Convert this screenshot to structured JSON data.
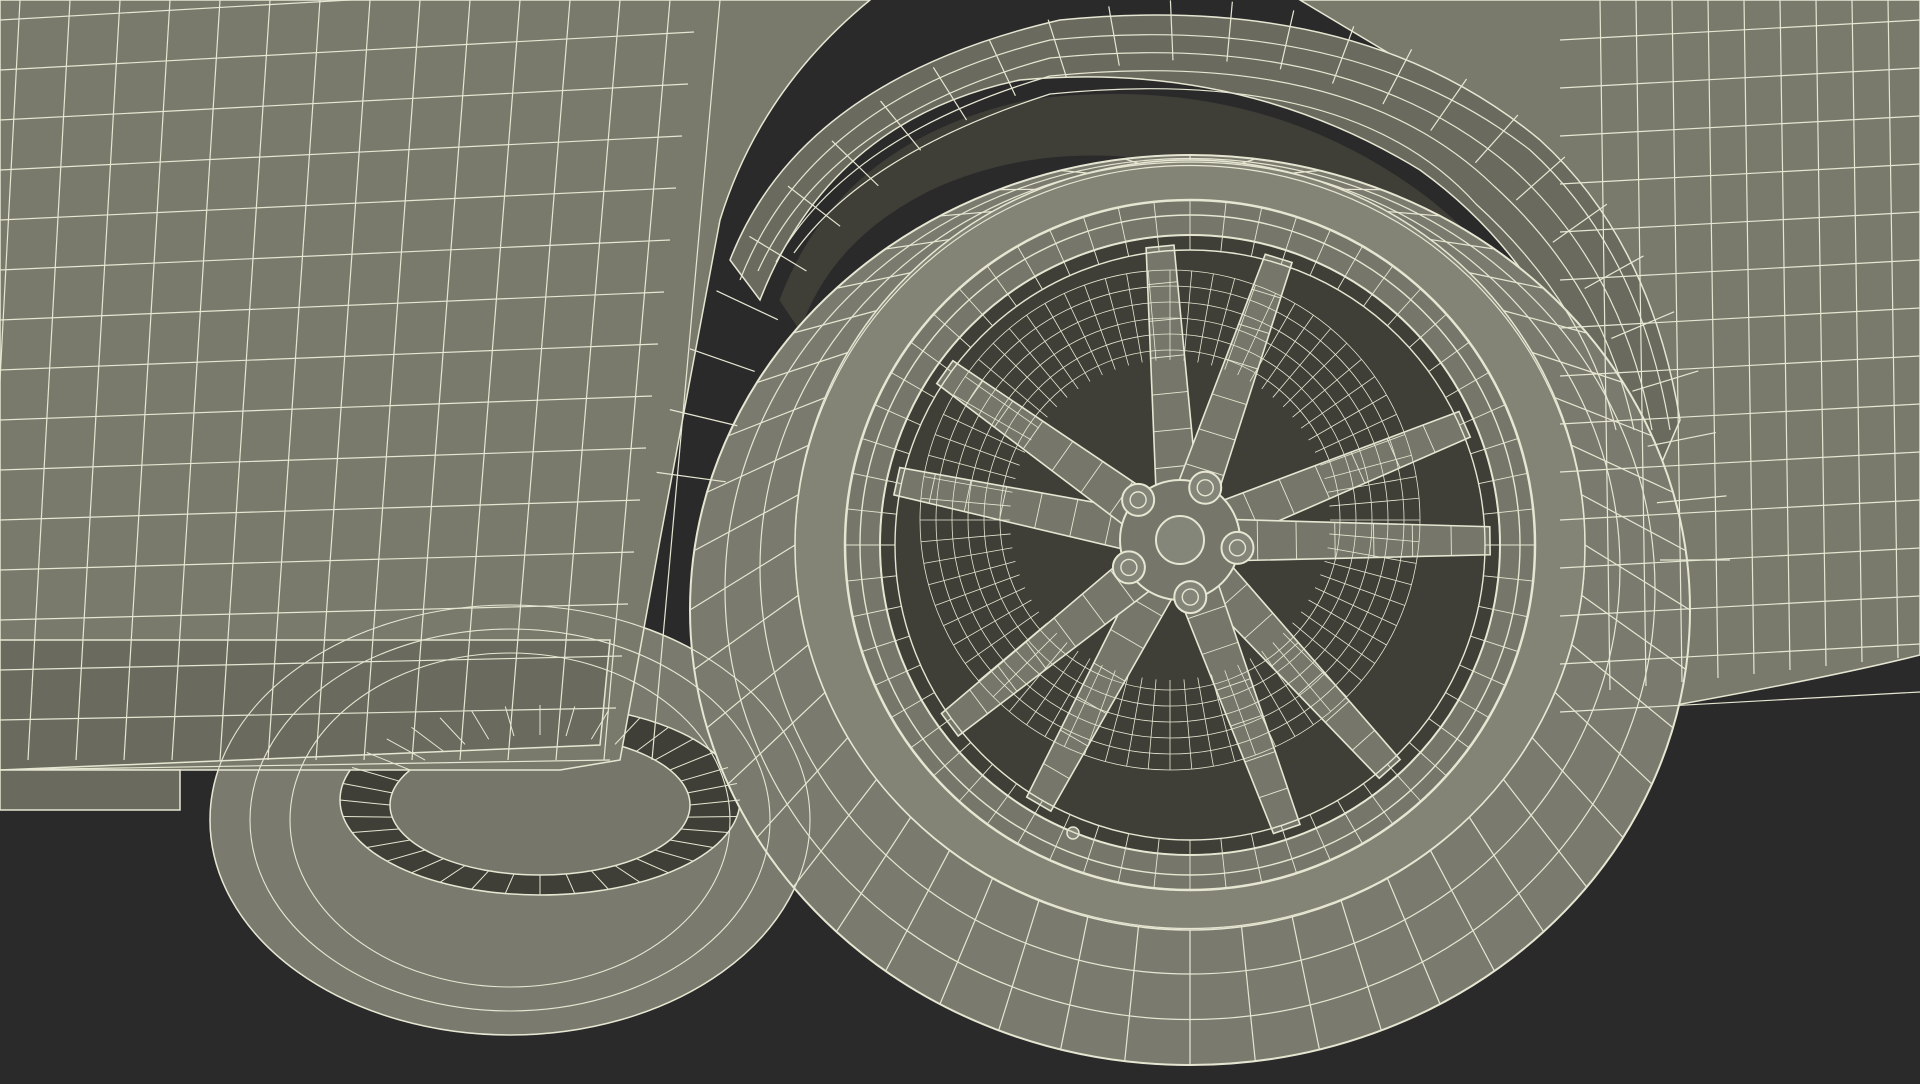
{
  "scene": {
    "colors": {
      "background": "#2a2a2a",
      "body_face": "#797a6c",
      "body_shade": "#6a6b5e",
      "wheel_well": "#3f3f38",
      "tire_face": "#7a7b6e",
      "tire_side": "#838476",
      "rim": "#76776a",
      "disc": "#85867a",
      "wire": "#e6e6d2"
    }
  }
}
